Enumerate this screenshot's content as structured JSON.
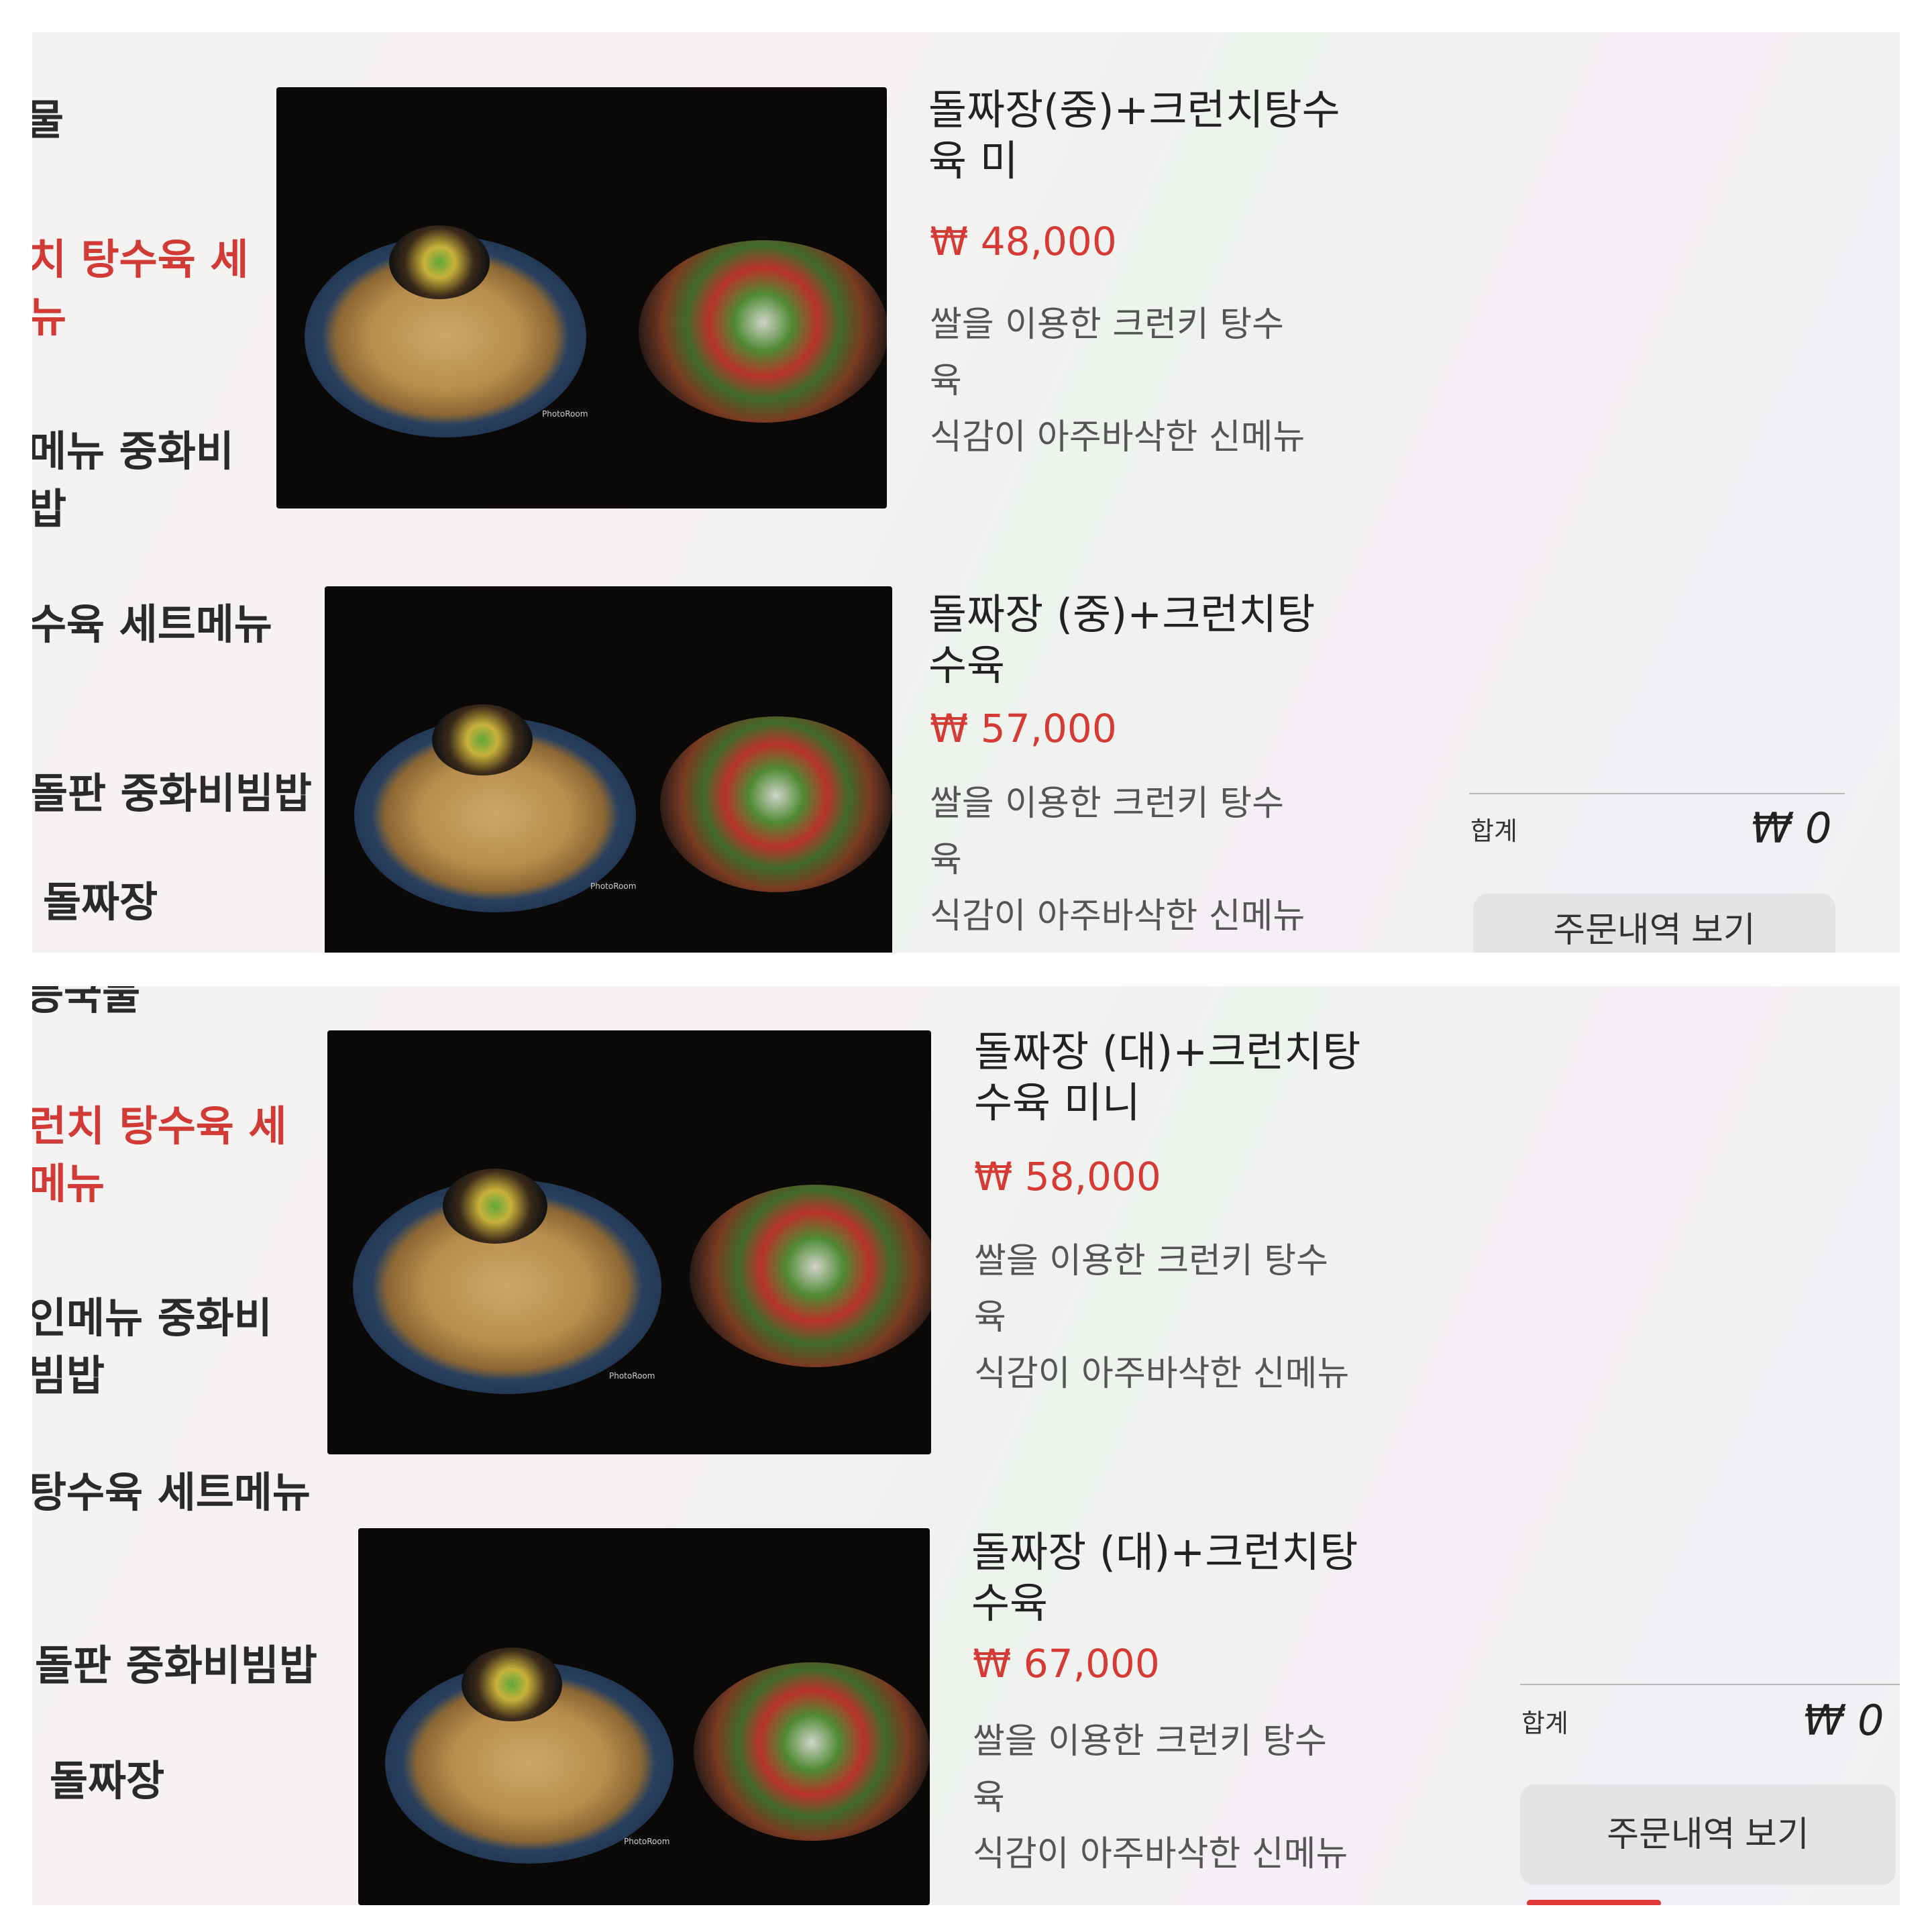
{
  "screens": [
    {
      "categories": [
        {
          "label": "물",
          "active": false
        },
        {
          "label": "치 탕수육 세\n뉴",
          "active": true
        },
        {
          "label": "메뉴  중화비\n밥",
          "active": false
        },
        {
          "label": "수육 세트메뉴",
          "active": false
        },
        {
          "label": "돌판 중화비빔밥",
          "active": false
        },
        {
          "label": "돌짜장",
          "active": false
        }
      ],
      "items": [
        {
          "name": "돌짜장(중)+크런치탕수\n육 미",
          "price": "₩ 48,000",
          "description": "쌀을 이용한 크런키 탕수\n육\n식감이 아주바삭한 신메뉴"
        },
        {
          "name": "돌짜장 (중)+크런치탕\n수육",
          "price": "₩ 57,000",
          "description": "쌀을 이용한 크런키 탕수\n육\n식감이 아주바삭한 신메뉴"
        }
      ],
      "summary": {
        "label": "합계",
        "value": "₩ 0"
      },
      "order_button": "주문내역 보기"
    },
    {
      "categories": [
        {
          "label": "등국물",
          "active": false
        },
        {
          "label": "런치 탕수육 세\n메뉴",
          "active": true
        },
        {
          "label": "인메뉴  중화비\n빔밥",
          "active": false
        },
        {
          "label": "탕수육 세트메뉴",
          "active": false
        },
        {
          "label": "돌판 중화비빔밥",
          "active": false
        },
        {
          "label": "돌짜장",
          "active": false
        }
      ],
      "items": [
        {
          "name": "돌짜장 (대)+크런치탕\n수육 미니",
          "price": "₩ 58,000",
          "description": "쌀을 이용한 크런키 탕수\n육\n식감이 아주바삭한 신메뉴"
        },
        {
          "name": "돌짜장 (대)+크런치탕\n수육",
          "price": "₩ 67,000",
          "description": "쌀을 이용한 크런키 탕수\n육\n식감이 아주바삭한 신메뉴"
        }
      ],
      "summary": {
        "label": "합계",
        "value": "₩ 0"
      },
      "order_button": "주문내역 보기"
    }
  ],
  "colors": {
    "accent": "#d63a34",
    "button_bg": "#e4e4e6",
    "image_bg": "#0a0908"
  },
  "image_watermark": "PhotoRoom"
}
